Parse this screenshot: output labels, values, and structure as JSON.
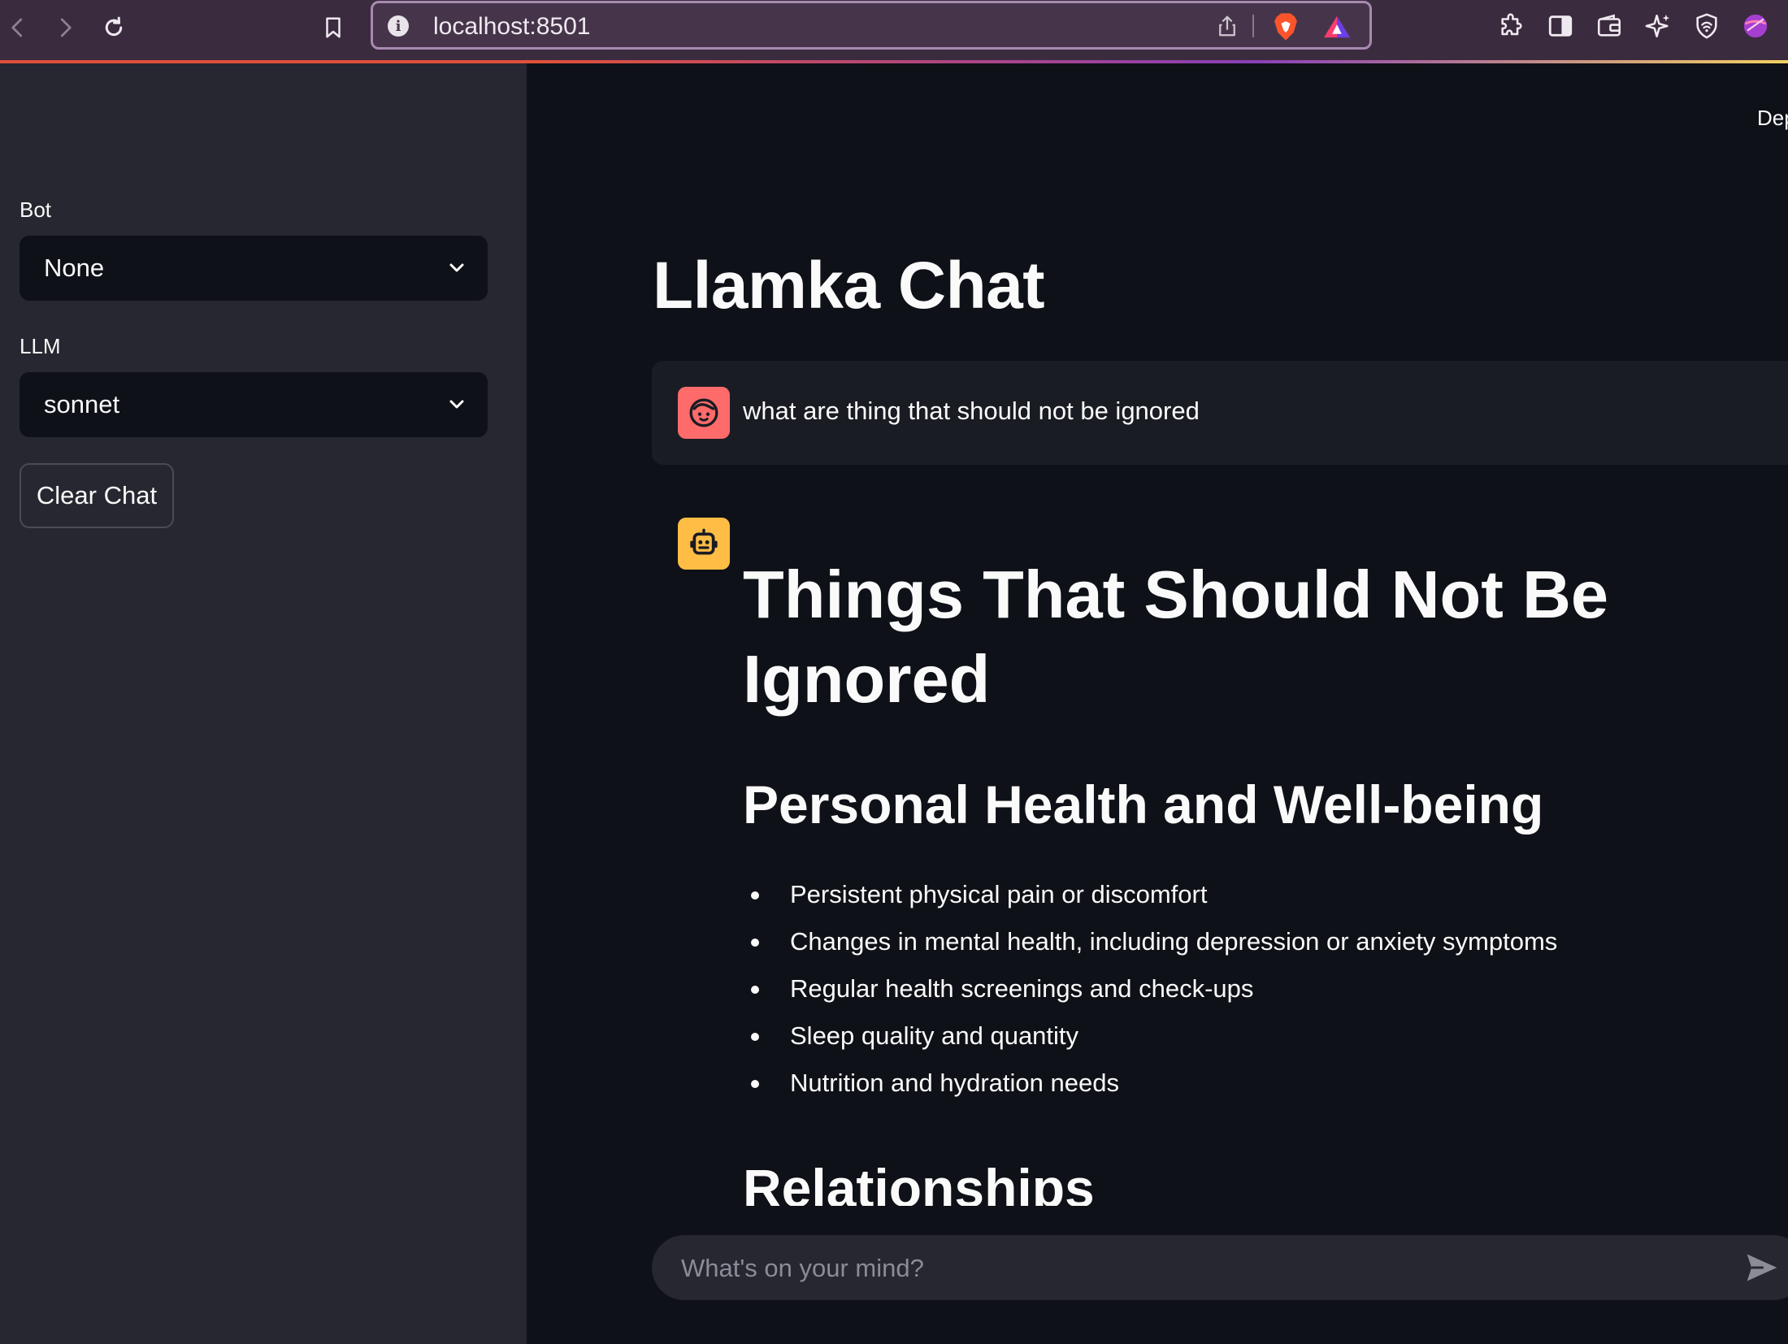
{
  "browser": {
    "url": "localhost:8501"
  },
  "sidebar": {
    "bot_label": "Bot",
    "bot_value": "None",
    "llm_label": "LLM",
    "llm_value": "sonnet",
    "clear_button": "Clear Chat"
  },
  "header": {
    "deploy_text": "Dep"
  },
  "main": {
    "title": "Llamka Chat",
    "user_message": "what are thing that should not be ignored",
    "response": {
      "heading": "Things That Should Not Be Ignored",
      "section1_title": "Personal Health and Well-being",
      "section1_items": [
        "Persistent physical pain or discomfort",
        "Changes in mental health, including depression or anxiety symptoms",
        "Regular health screenings and check-ups",
        "Sleep quality and quantity",
        "Nutrition and hydration needs"
      ],
      "section2_title": "Relationships"
    },
    "chat_input_placeholder": "What's on your mind?"
  },
  "colors": {
    "sidebar_bg": "#262730",
    "main_bg": "#0e1117",
    "user_avatar": "#ff6b6b",
    "bot_avatar": "#ffbd45"
  }
}
